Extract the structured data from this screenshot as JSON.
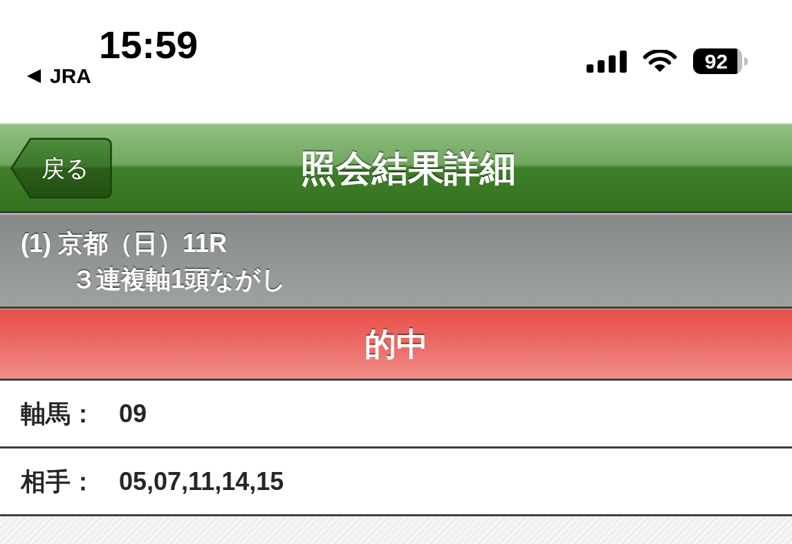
{
  "status_bar": {
    "time": "15:59",
    "back_app": "JRA",
    "battery": "92"
  },
  "nav_bar": {
    "back_button": "戻る",
    "title": "照会結果詳細"
  },
  "race_info": {
    "line_1": "(1) 京都（日）11R",
    "line_2": "３連複軸1頭ながし"
  },
  "result_banner": {
    "kind": "hit",
    "text": "的中"
  },
  "rows": [
    {
      "label": "軸馬：",
      "value": "09"
    },
    {
      "label": "相手：",
      "value": "05,07,11,14,15"
    }
  ]
}
